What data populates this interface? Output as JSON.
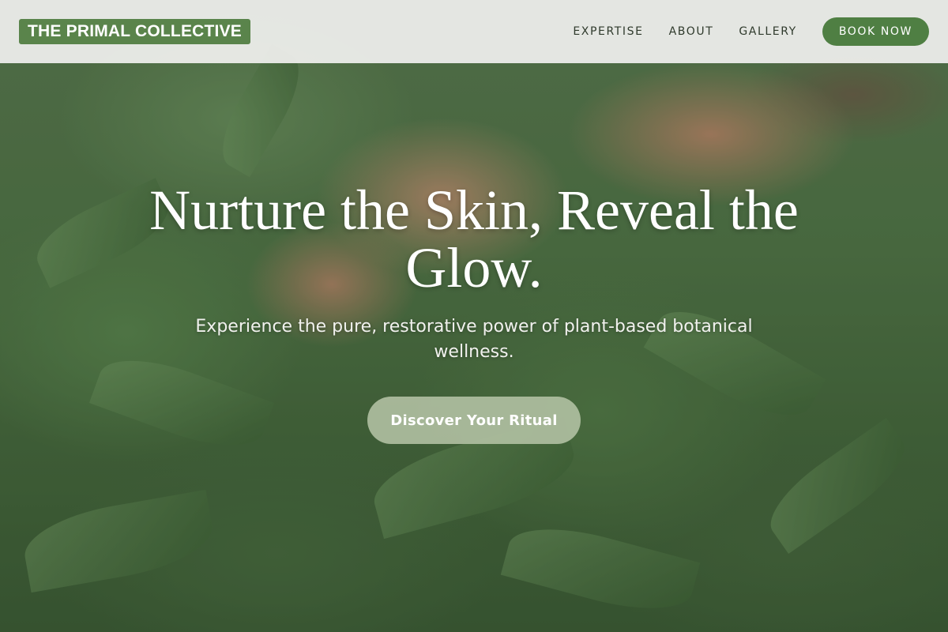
{
  "header": {
    "logo_text": "THE PRIMAL COLLECTIVE",
    "nav": [
      {
        "label": "EXPERTISE"
      },
      {
        "label": "ABOUT"
      },
      {
        "label": "GALLERY"
      }
    ],
    "book_label": "BOOK NOW"
  },
  "hero": {
    "headline": "Nurture the Skin, Reveal the Glow.",
    "subline": "Experience the pure, restorative power of plant-based botanical wellness.",
    "cta_label": "Discover Your Ritual",
    "background_image": "hand-touching-cannabis-plant-photo"
  },
  "colors": {
    "brand_green": "#5a844b",
    "button_green": "#4f7f43",
    "cta_sage": "#b4c3a5",
    "header_bg": "#f0f0ee",
    "nav_text": "#2f3a2c"
  }
}
